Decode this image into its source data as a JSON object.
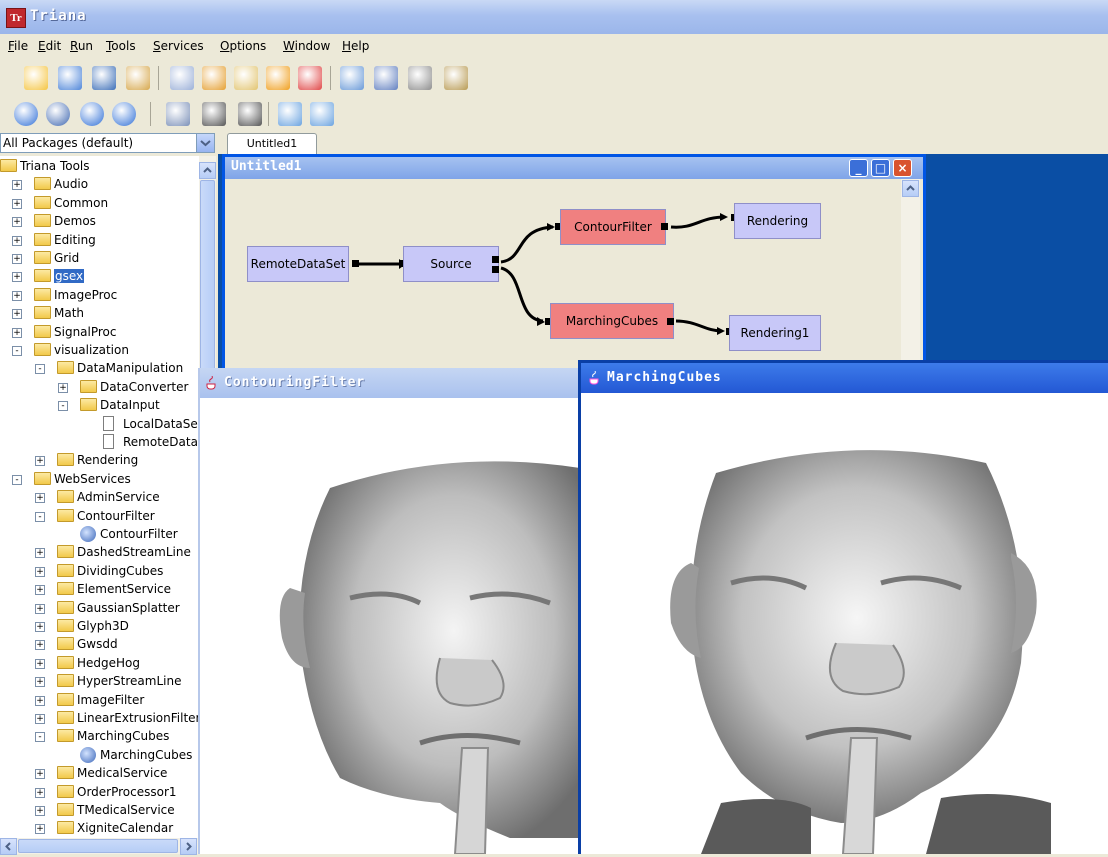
{
  "window": {
    "title": "Triana"
  },
  "menu": [
    {
      "label": "File",
      "underline": "F",
      "rest": "ile"
    },
    {
      "label": "Edit",
      "underline": "E",
      "rest": "dit"
    },
    {
      "label": "Run",
      "underline": "R",
      "rest": "un"
    },
    {
      "label": "Tools",
      "underline": "T",
      "rest": "ools"
    },
    {
      "label": "Services",
      "underline": "S",
      "rest": "ervices"
    },
    {
      "label": "Options",
      "underline": "O",
      "rest": "ptions"
    },
    {
      "label": "Window",
      "underline": "W",
      "rest": "indow"
    },
    {
      "label": "Help",
      "underline": "H",
      "rest": "elp"
    }
  ],
  "toolbar1": [
    "new-icon",
    "open-icon",
    "save-icon",
    "save-as-icon",
    "copy-icon",
    "cut-icon",
    "paste-icon",
    "group-icon",
    "delete-icon",
    "find-icon",
    "print-icon",
    "properties-icon",
    "help-book-icon"
  ],
  "toolbar2": [
    "run-icon",
    "step-icon",
    "stop-icon",
    "reset-icon",
    "debug-icon",
    "select-group-icon",
    "ungroup-icon",
    "zoom-in-icon",
    "zoom-out-icon"
  ],
  "packages": {
    "selected": "All Packages (default)"
  },
  "tree": [
    {
      "label": "Triana Tools",
      "depth": 0,
      "type": "folder-open",
      "exp": ""
    },
    {
      "label": "Audio",
      "depth": 1,
      "type": "folder",
      "exp": "+"
    },
    {
      "label": "Common",
      "depth": 1,
      "type": "folder",
      "exp": "+"
    },
    {
      "label": "Demos",
      "depth": 1,
      "type": "folder",
      "exp": "+"
    },
    {
      "label": "Editing",
      "depth": 1,
      "type": "folder",
      "exp": "+"
    },
    {
      "label": "Grid",
      "depth": 1,
      "type": "folder",
      "exp": "+"
    },
    {
      "label": "gsex",
      "depth": 1,
      "type": "folder",
      "exp": "+",
      "selected": true
    },
    {
      "label": "ImageProc",
      "depth": 1,
      "type": "folder",
      "exp": "+"
    },
    {
      "label": "Math",
      "depth": 1,
      "type": "folder",
      "exp": "+"
    },
    {
      "label": "SignalProc",
      "depth": 1,
      "type": "folder",
      "exp": "+"
    },
    {
      "label": "visualization",
      "depth": 1,
      "type": "folder-open",
      "exp": "-"
    },
    {
      "label": "DataManipulation",
      "depth": 2,
      "type": "folder-open",
      "exp": "-"
    },
    {
      "label": "DataConverter",
      "depth": 3,
      "type": "folder",
      "exp": "+"
    },
    {
      "label": "DataInput",
      "depth": 3,
      "type": "folder-open",
      "exp": "-"
    },
    {
      "label": "LocalDataSet",
      "depth": 4,
      "type": "doc",
      "exp": ""
    },
    {
      "label": "RemoteDataSet",
      "depth": 4,
      "type": "doc",
      "exp": ""
    },
    {
      "label": "Rendering",
      "depth": 2,
      "type": "folder",
      "exp": "+"
    },
    {
      "label": "WebServices",
      "depth": 1,
      "type": "folder-open",
      "exp": "-"
    },
    {
      "label": "AdminService",
      "depth": 2,
      "type": "folder",
      "exp": "+"
    },
    {
      "label": "ContourFilter",
      "depth": 2,
      "type": "folder-open",
      "exp": "-"
    },
    {
      "label": "ContourFilter",
      "depth": 3,
      "type": "service",
      "exp": ""
    },
    {
      "label": "DashedStreamLine",
      "depth": 2,
      "type": "folder",
      "exp": "+"
    },
    {
      "label": "DividingCubes",
      "depth": 2,
      "type": "folder",
      "exp": "+"
    },
    {
      "label": "ElementService",
      "depth": 2,
      "type": "folder",
      "exp": "+"
    },
    {
      "label": "GaussianSplatter",
      "depth": 2,
      "type": "folder",
      "exp": "+"
    },
    {
      "label": "Glyph3D",
      "depth": 2,
      "type": "folder",
      "exp": "+"
    },
    {
      "label": "Gwsdd",
      "depth": 2,
      "type": "folder",
      "exp": "+"
    },
    {
      "label": "HedgeHog",
      "depth": 2,
      "type": "folder",
      "exp": "+"
    },
    {
      "label": "HyperStreamLine",
      "depth": 2,
      "type": "folder",
      "exp": "+"
    },
    {
      "label": "ImageFilter",
      "depth": 2,
      "type": "folder",
      "exp": "+"
    },
    {
      "label": "LinearExtrusionFilter",
      "depth": 2,
      "type": "folder",
      "exp": "+"
    },
    {
      "label": "MarchingCubes",
      "depth": 2,
      "type": "folder-open",
      "exp": "-"
    },
    {
      "label": "MarchingCubes",
      "depth": 3,
      "type": "service",
      "exp": ""
    },
    {
      "label": "MedicalService",
      "depth": 2,
      "type": "folder",
      "exp": "+"
    },
    {
      "label": "OrderProcessor1",
      "depth": 2,
      "type": "folder",
      "exp": "+"
    },
    {
      "label": "TMedicalService",
      "depth": 2,
      "type": "folder",
      "exp": "+"
    },
    {
      "label": "XigniteCalendar",
      "depth": 2,
      "type": "folder",
      "exp": "+"
    }
  ],
  "workspace": {
    "tab": "Untitled1",
    "subwindow_title": "Untitled1",
    "units": {
      "remote": "RemoteDataSet",
      "source": "Source",
      "contour": "ContourFilter",
      "marching": "MarchingCubes",
      "rendering": "Rendering",
      "rendering1": "Rendering1"
    }
  },
  "viewers": {
    "contour": "ContouringFilter",
    "marching": "MarchingCubes"
  },
  "colors": {
    "unit_blue": "#c8c8f8",
    "unit_red": "#f08080",
    "selection": "#316ac5",
    "workspace_bg": "#0a4ea4"
  }
}
